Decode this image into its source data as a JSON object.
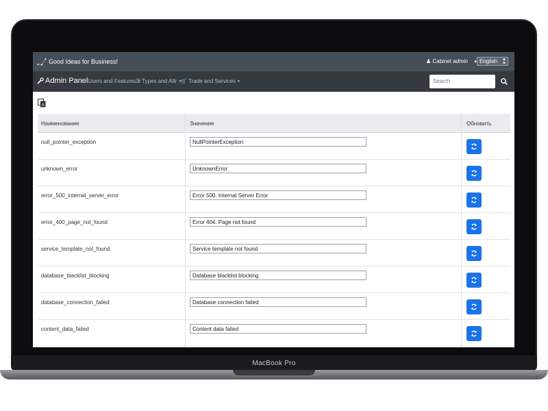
{
  "device": {
    "label": "MacBook Pro"
  },
  "topbar": {
    "brand": "Good Ideas for Business!",
    "cabinet_label": "Cabinet",
    "cabinet_user": "admin",
    "language": "English"
  },
  "navbar": {
    "title": "Admin Panel",
    "menu": [
      "Users and Features",
      "Types and Attr",
      "Trade and Services"
    ],
    "search_placeholder": "Search"
  },
  "table": {
    "headers": {
      "name": "Наименование",
      "value": "Значение",
      "update": "Обновить"
    },
    "rows": [
      {
        "name": "null_pointer_exception",
        "value": "NullPointerException"
      },
      {
        "name": "unknown_error",
        "value": "UnknownError"
      },
      {
        "name": "error_500_internal_server_error",
        "value": "Error 500. Internal Server Error"
      },
      {
        "name": "error_400_page_not_found",
        "value": "Error 404. Page not found"
      },
      {
        "name": "service_template_not_found",
        "value": "Service template not found"
      },
      {
        "name": "database_blacklist_blocking",
        "value": "Database blacklist blocking"
      },
      {
        "name": "database_connection_failed",
        "value": "Database connection failed"
      },
      {
        "name": "content_data_failed",
        "value": "Content data failed"
      }
    ]
  },
  "colors": {
    "topbar": "#464f58",
    "navbar": "#343a40",
    "accent": "#1a73e8",
    "header_bg": "#e9ecef"
  }
}
